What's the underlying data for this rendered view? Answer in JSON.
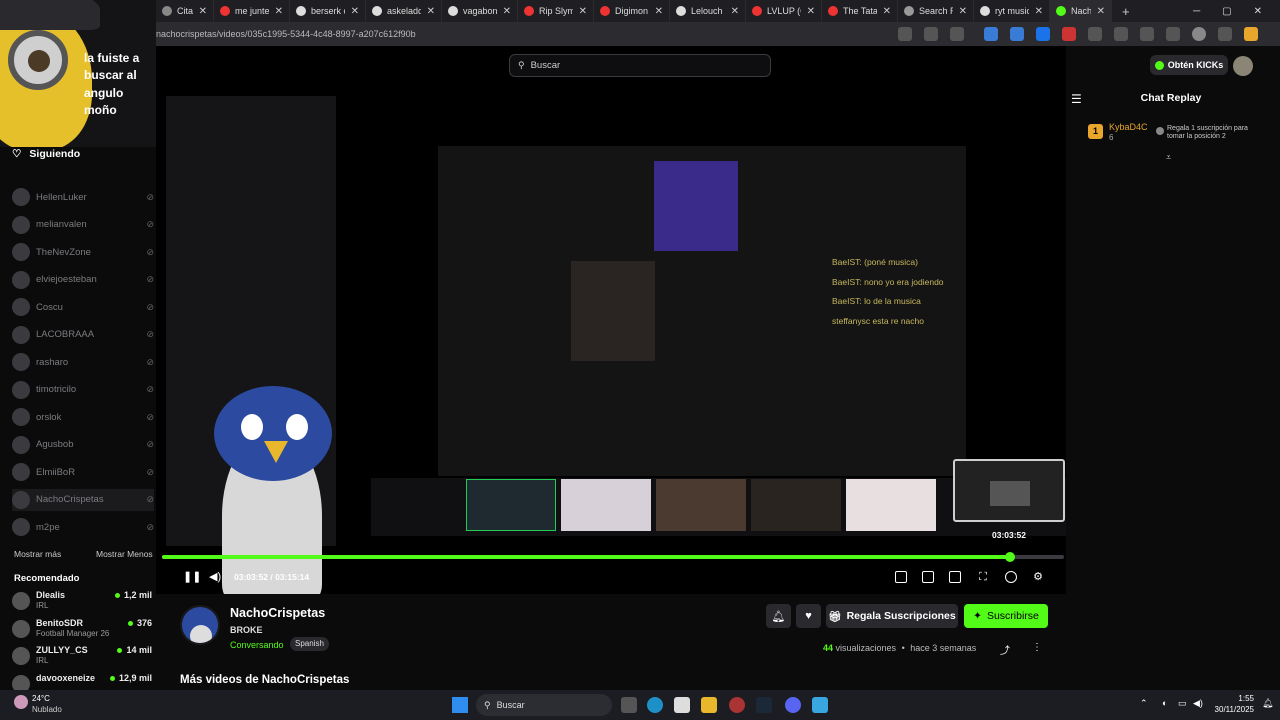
{
  "browser": {
    "tabs": [
      {
        "label": "Citas de est",
        "color": "#888"
      },
      {
        "label": "me junte co",
        "color": "#e33"
      },
      {
        "label": "berserk cau",
        "color": "#ddd"
      },
      {
        "label": "askeladd -",
        "color": "#ddd"
      },
      {
        "label": "vagabond",
        "color": "#ddd"
      },
      {
        "label": "Rip Slyme -",
        "color": "#e33"
      },
      {
        "label": "Digimon Ac",
        "color": "#e33"
      },
      {
        "label": "Lelouch Lan",
        "color": "#ddd"
      },
      {
        "label": "LVLUP (Offi",
        "color": "#e33"
      },
      {
        "label": "The Tatami",
        "color": "#e33"
      },
      {
        "label": "Search Res",
        "color": "#999"
      },
      {
        "label": "ryt music to",
        "color": "#ddd"
      },
      {
        "label": "Nacho",
        "color": "#53fc18"
      }
    ],
    "url": "nachocrispetas/videos/035c1995-5344-4c48-8997-a207c612f90b"
  },
  "meme": {
    "text": "la fuiste a buscar al angulo moño"
  },
  "sidebar": {
    "following_label": "Siguiendo",
    "channels": [
      "HellenLuker",
      "melianvalen",
      "TheNevZone",
      "elviejoesteban",
      "Coscu",
      "LACOBRAAA",
      "rasharo",
      "timotricilo",
      "orslok",
      "Agusbob",
      "ElmiiBoR",
      "NachoCrispetas",
      "m2pe"
    ],
    "show_more": "Mostrar más",
    "show_less": "Mostrar Menos",
    "recommended_label": "Recomendado",
    "recommended": [
      {
        "name": "Dlealis",
        "game": "IRL",
        "viewers": "1,2 mil"
      },
      {
        "name": "BenitoSDR",
        "game": "Football Manager 26",
        "viewers": "376"
      },
      {
        "name": "ZULLYY_CS",
        "game": "IRL",
        "viewers": "14 mil"
      },
      {
        "name": "davooxeneize",
        "game": "",
        "viewers": "12,9 mil"
      }
    ]
  },
  "search": {
    "placeholder": "Buscar"
  },
  "chat": {
    "kicks_button": "Obtén KICKs",
    "title": "Chat Replay",
    "gift_user": "KybaD4C",
    "gift_count": "6",
    "gift_text": "Regala 1 suscripción para tomar la posición 2"
  },
  "player": {
    "time": "03:03:52 / 03:15:14",
    "preview_time": "03:03:52",
    "progress": 0.94
  },
  "channel": {
    "name": "NachoCrispetas",
    "status": "BROKE",
    "category": "Conversando",
    "tag": "Spanish",
    "gift_button": "Regala Suscripciones",
    "subscribe_button": "Suscribirse",
    "views_count": "44",
    "views_label": "visualizaciones",
    "ago": "hace 3 semanas",
    "more_videos": "Más videos de NachoCrispetas"
  },
  "video_overlay": {
    "chat_lines": [
      "BaeIST: (poné musica)",
      "BaeIST: nono yo era jodiendo",
      "BaeIST: lo de la musica",
      "steffanysc esta re nacho"
    ]
  },
  "taskbar": {
    "weather_temp": "24°C",
    "weather_desc": "Nublado",
    "search": "Buscar",
    "time": "1:55",
    "date": "30/11/2025"
  }
}
